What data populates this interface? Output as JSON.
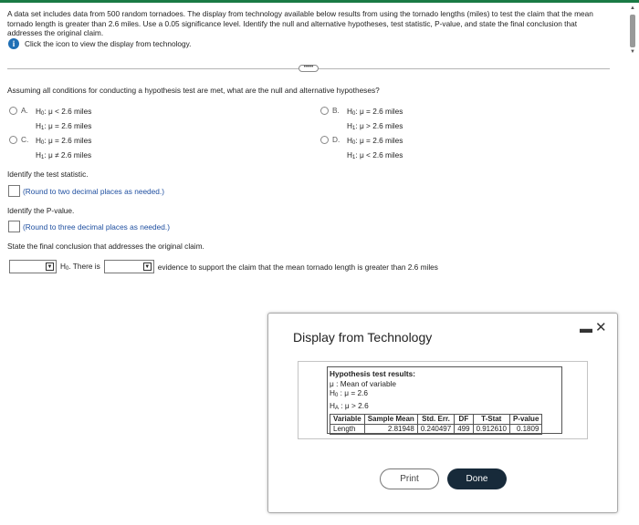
{
  "intro": {
    "text": "A data set includes data from 500 random tornadoes. The display from technology available below results from using the tornado lengths (miles) to test the claim that the mean tornado length is greater than 2.6 miles. Use a 0.05 significance level. Identify the null and alternative hypotheses, test statistic, P-value, and state the final conclusion that addresses the original claim.",
    "info_link": "Click the icon to view the display from technology."
  },
  "ellipsis": "•••••",
  "question1": "Assuming all conditions for conducting a hypothesis test are met, what are the null and alternative hypotheses?",
  "options": [
    {
      "letter": "A.",
      "h0_rel": "μ < 2.6 miles",
      "h1_rel": "μ = 2.6 miles"
    },
    {
      "letter": "B.",
      "h0_rel": "μ = 2.6 miles",
      "h1_rel": "μ > 2.6 miles"
    },
    {
      "letter": "C.",
      "h0_rel": "μ = 2.6 miles",
      "h1_rel": "μ ≠ 2.6 miles"
    },
    {
      "letter": "D.",
      "h0_rel": "μ = 2.6 miles",
      "h1_rel": "μ < 2.6 miles"
    }
  ],
  "hyp_labels": {
    "h0": "H",
    "h0_sub": "0",
    "h1": "H",
    "h1_sub": "1"
  },
  "question2": "Identify the test statistic.",
  "note2": "(Round to two decimal places as needed.)",
  "question3": "Identify the P-value.",
  "note3": "(Round to three decimal places as needed.)",
  "question4": "State the final conclusion that addresses the original claim.",
  "conclusion": {
    "h0": "H",
    "h0_sub": "0",
    "mid": ". There is",
    "end": "evidence to support the claim that the mean tornado length is greater than 2.6 miles"
  },
  "popup": {
    "title": "Display from Technology",
    "minimize": "▬",
    "close": "✕",
    "results": {
      "heading": "Hypothesis test results:",
      "mu_line": "μ : Mean of variable",
      "h0_line_label": "H",
      "h0_line_sub": "0",
      "h0_line_rest": " : μ = 2.6",
      "ha_line_label": "H",
      "ha_line_sub": "A",
      "ha_line_rest": " : μ > 2.6",
      "columns": [
        "Variable",
        "Sample Mean",
        "Std. Err.",
        "DF",
        "T-Stat",
        "P-value"
      ],
      "row": [
        "Length",
        "2.81948",
        "0.240497",
        "499",
        "0.912610",
        "0.1809"
      ]
    },
    "print_label": "Print",
    "done_label": "Done"
  }
}
